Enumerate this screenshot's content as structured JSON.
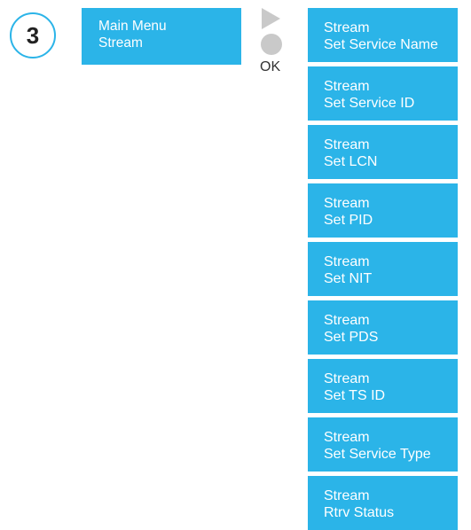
{
  "step": {
    "number": "3"
  },
  "main_menu": {
    "line1": "Main Menu",
    "line2": "Stream"
  },
  "controls": {
    "play_icon": "play-triangle-icon",
    "ok_button_icon": "circle-button-icon",
    "ok_label": "OK"
  },
  "submenu": {
    "items": [
      {
        "line1": "Stream",
        "line2": "Set Service Name"
      },
      {
        "line1": "Stream",
        "line2": "Set Service ID"
      },
      {
        "line1": "Stream",
        "line2": "Set LCN"
      },
      {
        "line1": "Stream",
        "line2": "Set PID"
      },
      {
        "line1": "Stream",
        "line2": "Set NIT"
      },
      {
        "line1": "Stream",
        "line2": "Set PDS"
      },
      {
        "line1": "Stream",
        "line2": "Set TS ID"
      },
      {
        "line1": "Stream",
        "line2": "Set Service Type"
      },
      {
        "line1": "Stream",
        "line2": "Rtrv Status"
      }
    ]
  },
  "colors": {
    "menu_box": "#2bb4e8",
    "menu_text": "#ffffff",
    "control_gray": "#c9c9c9",
    "step_border": "#2bb4e8"
  }
}
